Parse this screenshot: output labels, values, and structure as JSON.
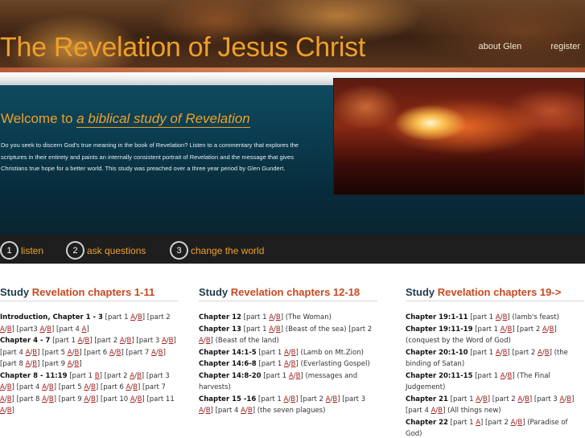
{
  "header": {
    "title": "The Revelation of Jesus Christ",
    "nav": [
      {
        "label": "about Glen"
      },
      {
        "label": "register"
      }
    ]
  },
  "hero": {
    "welcome_prefix": "Welcome to",
    "welcome_emphasis": "a biblical study of Revelation",
    "intro_text": "Do you seek to discern God's true meaning in the book of Revelation? Listen to a commentary that explores the scriptures in their entirety and paints an internally consistent portrait of Revelation and the message that gives Christians true hope for a better world. This study was preached over a three year period by Glen Gundert."
  },
  "steps": [
    {
      "number": "1",
      "label": "listen"
    },
    {
      "number": "2",
      "label": "ask questions"
    },
    {
      "number": "3",
      "label": "change the world"
    }
  ],
  "columns": [
    {
      "title_prefix": "Study",
      "title_highlight": "Revelation chapters 1-11",
      "entries": [
        {
          "heading": "Introduction, Chapter 1 - 3",
          "links": [
            [
              "part 1",
              "A",
              "B"
            ],
            [
              "part 2",
              "A",
              "B"
            ],
            [
              "part3",
              "A",
              "B"
            ],
            [
              "part 4",
              "A"
            ]
          ],
          "note": ""
        },
        {
          "heading": "Chapter 4 - 7",
          "links": [
            [
              "part 1",
              "A",
              "B"
            ],
            [
              "part 2",
              "A",
              "B"
            ],
            [
              "part 3",
              "A",
              "B"
            ],
            [
              "part 4",
              "A",
              "B"
            ],
            [
              "part 5",
              "A",
              "B"
            ],
            [
              "part 6",
              "A",
              "B"
            ],
            [
              "part 7",
              "A",
              "B"
            ],
            [
              "part 8",
              "A",
              "B"
            ],
            [
              "part 9",
              "A",
              "B"
            ]
          ],
          "note": ""
        },
        {
          "heading": "Chapter 8 - 11:19",
          "links": [
            [
              "part 1",
              "B"
            ],
            [
              "part 2",
              "A",
              "B"
            ],
            [
              "part 3",
              "A",
              "B"
            ],
            [
              "part 4",
              "A",
              "B"
            ],
            [
              "part 5",
              "A",
              "B"
            ],
            [
              "part 6",
              "A",
              "B"
            ],
            [
              "part 7",
              "A",
              "B"
            ],
            [
              "part 8",
              "A",
              "B"
            ],
            [
              "part 9",
              "A",
              "B"
            ],
            [
              "part 10",
              "A",
              "B"
            ],
            [
              "part 11",
              "A",
              "B"
            ]
          ],
          "note": ""
        }
      ]
    },
    {
      "title_prefix": "Study",
      "title_highlight": "Revelation chapters 12-18",
      "entries": [
        {
          "heading": "Chapter 12",
          "links": [
            [
              "part 1",
              "A",
              "B"
            ]
          ],
          "note": "(The Woman)"
        },
        {
          "heading": "Chapter 13",
          "links": [
            [
              "part 1",
              "A",
              "B"
            ]
          ],
          "note": "(Beast of the sea)",
          "links2": [
            [
              "part 2",
              "A",
              "B"
            ]
          ],
          "note2": "(Beast of the land)"
        },
        {
          "heading": "Chapter 14:1-5",
          "links": [
            [
              "part 1",
              "A",
              "B"
            ]
          ],
          "note": "(Lamb on Mt.Zion)"
        },
        {
          "heading": "Chapter 14:6-8",
          "links": [
            [
              "part 1",
              "A",
              "B"
            ]
          ],
          "note": "(Everlasting Gospel)"
        },
        {
          "heading": "Chapter 14:8-20",
          "links": [
            [
              "part 1",
              "A",
              "B"
            ]
          ],
          "note": "(messages and harvests)"
        },
        {
          "heading": "Chapter 15 -16",
          "links": [
            [
              "part 1",
              "A",
              "B"
            ],
            [
              "part 2",
              "A",
              "B"
            ],
            [
              "part 3",
              "A",
              "B"
            ],
            [
              "part 4",
              "A",
              "B"
            ]
          ],
          "note": "(the seven plagues)"
        }
      ]
    },
    {
      "title_prefix": "Study",
      "title_highlight": "Revelation chapters 19->",
      "entries": [
        {
          "heading": "Chapter 19:1-11",
          "links": [
            [
              "part 1",
              "A",
              "B"
            ]
          ],
          "note": "(lamb's feast)"
        },
        {
          "heading": "Chapter 19:11-19",
          "links": [
            [
              "part 1",
              "A",
              "B"
            ],
            [
              "part 2",
              "A",
              "B"
            ]
          ],
          "note": "(conquest by the Word of God)"
        },
        {
          "heading": "Chapter 20:1-10",
          "links": [
            [
              "part 1",
              "A",
              "B"
            ],
            [
              "part 2",
              "A",
              "B"
            ]
          ],
          "note": "(the binding of Satan)"
        },
        {
          "heading": "Chapter 20:11-15",
          "links": [
            [
              "part 1",
              "A",
              "B"
            ]
          ],
          "note": "(The Final Judgement)"
        },
        {
          "heading": "Chapter 21",
          "links": [
            [
              "part 1",
              "A",
              "B"
            ],
            [
              "part 2",
              "A",
              "B"
            ],
            [
              "part 3",
              "A",
              "B"
            ],
            [
              "part 4",
              "A",
              "B"
            ]
          ],
          "note": "(All things new)"
        },
        {
          "heading": "Chapter 22",
          "links": [
            [
              "part 1",
              "A"
            ],
            [
              "part 2",
              "A",
              "B"
            ]
          ],
          "note": "(Paradise of God)"
        }
      ]
    }
  ]
}
